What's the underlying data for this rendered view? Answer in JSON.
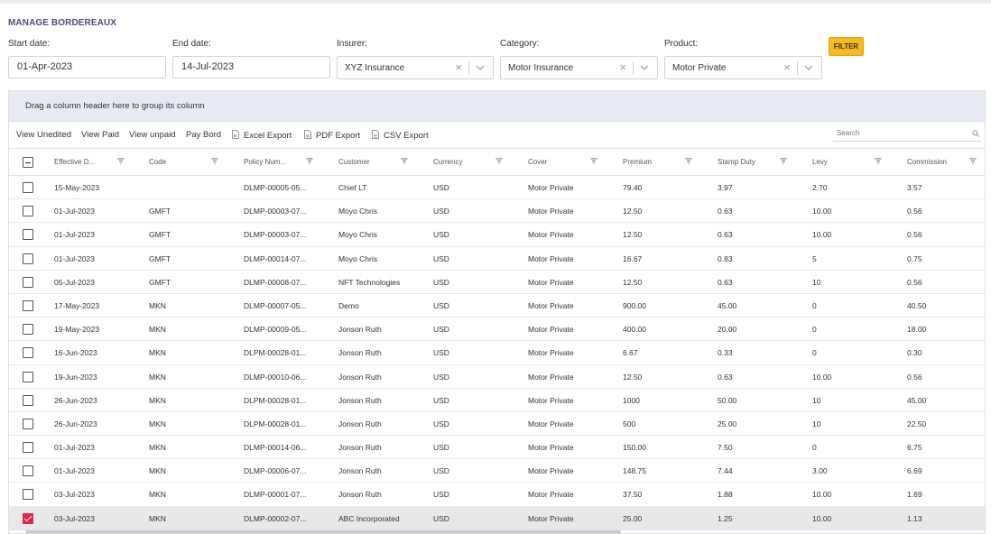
{
  "page": {
    "title": "MANAGE BORDEREAUX"
  },
  "filters": {
    "start_date": {
      "label": "Start date:",
      "value": "01-Apr-2023"
    },
    "end_date": {
      "label": "End date:",
      "value": "14-Jul-2023"
    },
    "insurer": {
      "label": "Insurer:",
      "value": "XYZ Insurance"
    },
    "category": {
      "label": "Category:",
      "value": "Motor Insurance"
    },
    "product": {
      "label": "Product:",
      "value": "Motor Private"
    },
    "clear_glyph": "×",
    "filter_button": "FILTER"
  },
  "grid": {
    "group_panel_text": "Drag a column header here to group its column",
    "toolbar": {
      "view_unedited": "View Unedited",
      "view_paid": "View Paid",
      "view_unpaid": "View unpaid",
      "pay_bord": "Pay Bord",
      "excel_export": "Excel Export",
      "pdf_export": "PDF Export",
      "csv_export": "CSV Export",
      "search_placeholder": "Search"
    },
    "columns": [
      "Effective D...",
      "Code",
      "Policy Num...",
      "Customer",
      "Currency",
      "Cover",
      "Premium",
      "Stamp Duty",
      "Levy",
      "Commission"
    ],
    "rows": [
      {
        "checked": false,
        "cells": [
          "15-May-2023",
          "",
          "DLMP-00005-05...",
          "Chief LT",
          "USD",
          "Motor Private",
          "79.40",
          "3.97",
          "2.70",
          "3.57"
        ]
      },
      {
        "checked": false,
        "cells": [
          "01-Jul-2023",
          "GMFT",
          "DLMP-00003-07...",
          "Moyo Chris",
          "USD",
          "Motor Private",
          "12.50",
          "0.63",
          "10.00",
          "0.56"
        ]
      },
      {
        "checked": false,
        "cells": [
          "01-Jul-2023",
          "GMFT",
          "DLMP-00003-07...",
          "Moyo Chris",
          "USD",
          "Motor Private",
          "12.50",
          "0.63",
          "10.00",
          "0.56"
        ]
      },
      {
        "checked": false,
        "cells": [
          "01-Jul-2023",
          "GMFT",
          "DLMP-00014-07...",
          "Moyo Chris",
          "USD",
          "Motor Private",
          "16.67",
          "0.83",
          "5",
          "0.75"
        ]
      },
      {
        "checked": false,
        "cells": [
          "05-Jul-2023",
          "GMFT",
          "DLMP-00008-07...",
          "NFT Technologies",
          "USD",
          "Motor Private",
          "12.50",
          "0.63",
          "10",
          "0.56"
        ]
      },
      {
        "checked": false,
        "cells": [
          "17-May-2023",
          "MKN",
          "DLMP-00007-05...",
          "Demo",
          "USD",
          "Motor Private",
          "900.00",
          "45.00",
          "0",
          "40.50"
        ]
      },
      {
        "checked": false,
        "cells": [
          "19-May-2023",
          "MKN",
          "DLMP-00009-05...",
          "Jonson Ruth",
          "USD",
          "Motor Private",
          "400.00",
          "20.00",
          "0",
          "18.00"
        ]
      },
      {
        "checked": false,
        "cells": [
          "16-Jun-2023",
          "MKN",
          "DLPM-00028-01...",
          "Jonson Ruth",
          "USD",
          "Motor Private",
          "6.67",
          "0.33",
          "0",
          "0.30"
        ]
      },
      {
        "checked": false,
        "cells": [
          "19-Jun-2023",
          "MKN",
          "DLMP-00010-06...",
          "Jonson Ruth",
          "USD",
          "Motor Private",
          "12.50",
          "0.63",
          "10.00",
          "0.56"
        ]
      },
      {
        "checked": false,
        "cells": [
          "26-Jun-2023",
          "MKN",
          "DLPM-00028-01...",
          "Jonson Ruth",
          "USD",
          "Motor Private",
          "1000",
          "50.00",
          "10",
          "45.00"
        ]
      },
      {
        "checked": false,
        "cells": [
          "26-Jun-2023",
          "MKN",
          "DLPM-00028-01...",
          "Jonson Ruth",
          "USD",
          "Motor Private",
          "500",
          "25.00",
          "10",
          "22.50"
        ]
      },
      {
        "checked": false,
        "cells": [
          "01-Jul-2023",
          "MKN",
          "DLMP-00014-06...",
          "Jonson Ruth",
          "USD",
          "Motor Private",
          "150.00",
          "7.50",
          "0",
          "6.75"
        ]
      },
      {
        "checked": false,
        "cells": [
          "01-Jul-2023",
          "MKN",
          "DLMP-00006-07...",
          "Jonson Ruth",
          "USD",
          "Motor Private",
          "148.75",
          "7.44",
          "3.00",
          "6.69"
        ]
      },
      {
        "checked": false,
        "cells": [
          "03-Jul-2023",
          "MKN",
          "DLMP-00001-07...",
          "Jonson Ruth",
          "USD",
          "Motor Private",
          "37.50",
          "1.88",
          "10.00",
          "1.69"
        ]
      },
      {
        "checked": true,
        "cells": [
          "03-Jul-2023",
          "MKN",
          "DLMP-00002-07...",
          "ABC Incorporated",
          "USD",
          "Motor Private",
          "25.00",
          "1.25",
          "10.00",
          "1.13"
        ]
      }
    ]
  },
  "colors": {
    "accent_yellow": "#f6b91f",
    "checkbox_checked": "#e0244e",
    "group_panel_bg": "#e8eaf3",
    "title_color": "#4b4f73"
  }
}
